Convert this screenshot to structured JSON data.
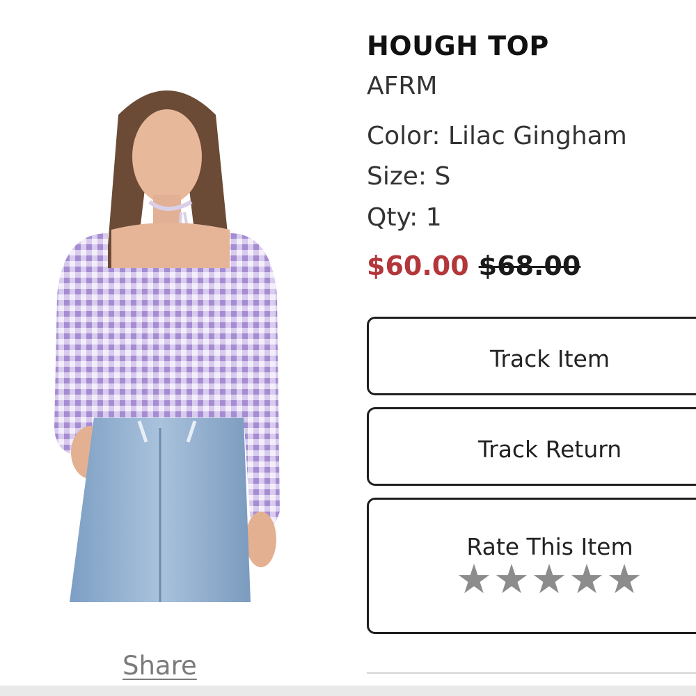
{
  "product": {
    "title": "HOUGH TOP",
    "brand": "AFRM",
    "color_line": "Color: Lilac Gingham",
    "size_line": "Size: S",
    "qty_line": "Qty: 1",
    "sale_price": "$60.00",
    "original_price": "$68.00",
    "image_alt": "model wearing lilac gingham top and jeans"
  },
  "actions": {
    "track_item": "Track Item",
    "track_return": "Track Return",
    "rate_item": "Rate This Item",
    "rating": {
      "stars_total": 5,
      "stars_filled": 0
    }
  },
  "share_label": "Share",
  "colors": {
    "sale_price": "#b3363b",
    "star": "#8c8c8c",
    "gingham": "#b7a2d8",
    "denim": "#8eaecd"
  }
}
